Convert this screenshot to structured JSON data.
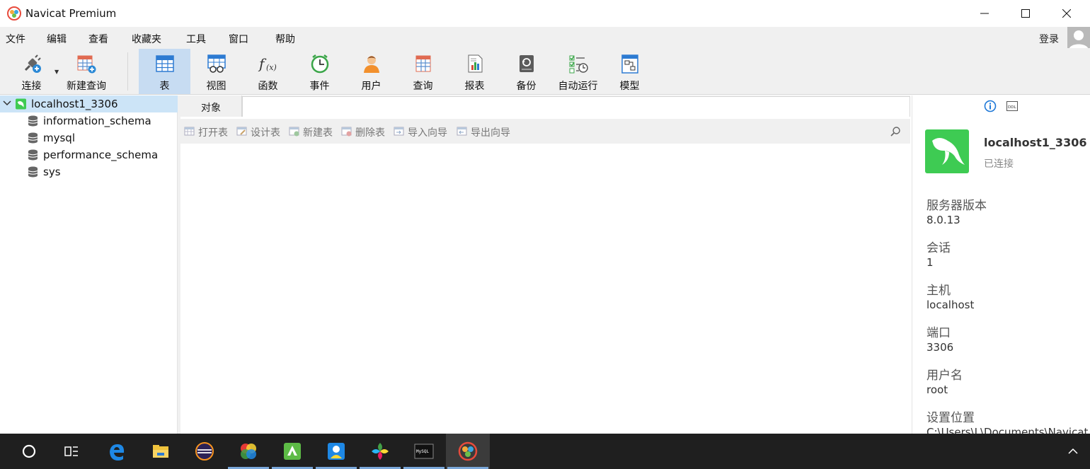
{
  "window": {
    "title": "Navicat Premium"
  },
  "menu": {
    "items": [
      "文件",
      "编辑",
      "查看",
      "收藏夹",
      "工具",
      "窗口",
      "帮助"
    ],
    "login": "登录"
  },
  "toolbar": {
    "items": [
      {
        "label": "连接",
        "icon": "connect-icon"
      },
      {
        "label": "新建查询",
        "icon": "new-query-icon"
      },
      {
        "label": "表",
        "icon": "table-icon",
        "active": true
      },
      {
        "label": "视图",
        "icon": "view-icon"
      },
      {
        "label": "函数",
        "icon": "function-icon"
      },
      {
        "label": "事件",
        "icon": "event-clock-icon"
      },
      {
        "label": "用户",
        "icon": "user-icon"
      },
      {
        "label": "查询",
        "icon": "query-icon"
      },
      {
        "label": "报表",
        "icon": "report-icon"
      },
      {
        "label": "备份",
        "icon": "backup-icon"
      },
      {
        "label": "自动运行",
        "icon": "automation-icon"
      },
      {
        "label": "模型",
        "icon": "model-icon"
      }
    ]
  },
  "navigator": {
    "connection": "localhost1_3306",
    "databases": [
      "information_schema",
      "mysql",
      "performance_schema",
      "sys"
    ]
  },
  "tabs": {
    "objects": "对象"
  },
  "object_toolbar": {
    "buttons": [
      "打开表",
      "设计表",
      "新建表",
      "删除表",
      "导入向导",
      "导出向导"
    ]
  },
  "info_panel": {
    "name": "localhost1_3306",
    "status": "已连接",
    "properties": [
      {
        "key": "服务器版本",
        "value": "8.0.13"
      },
      {
        "key": "会话",
        "value": "1"
      },
      {
        "key": "主机",
        "value": "localhost"
      },
      {
        "key": "端口",
        "value": "3306"
      },
      {
        "key": "用户名",
        "value": "root"
      },
      {
        "key": "设置位置",
        "value": "C:\\Users\\L\\Documents\\Navicat"
      }
    ]
  },
  "taskbar": {
    "items": [
      "start-button-icon",
      "task-view-icon",
      "edge-icon",
      "file-explorer-icon",
      "eclipse-icon",
      "photos-app-icon",
      "green-app-icon",
      "contacts-app-icon",
      "flower-app-icon",
      "mysql-console-icon",
      "navicat-taskbar-icon"
    ]
  },
  "colors": {
    "accent": "#c7dcf2",
    "selection": "#cce4f7",
    "mysql_green": "#3ecb53",
    "taskbar": "#1f1f1f"
  }
}
